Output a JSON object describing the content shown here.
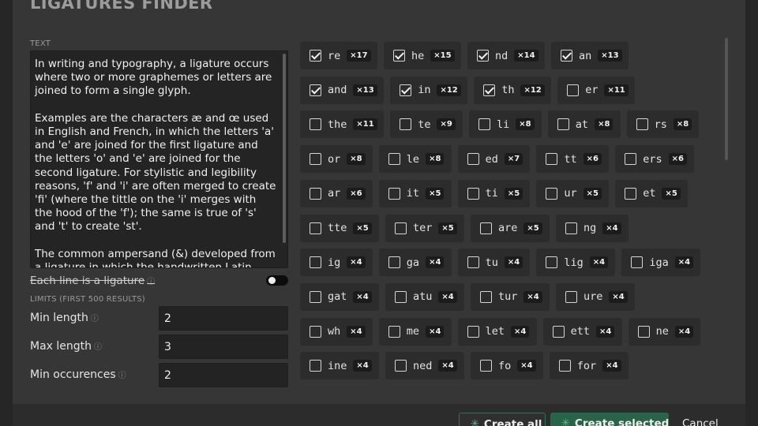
{
  "dialog": {
    "title": "LIGATURES FINDER"
  },
  "text_section": {
    "label": "TEXT",
    "content": "In writing and typography, a ligature occurs where two or more graphemes or letters are joined to form a single glyph.\n\nExamples are the characters æ and œ used in English and French, in which the letters 'a' and 'e' are joined for the first ligature and the letters 'o' and 'e' are joined for the second ligature. For stylistic and legibility reasons, 'f' and 'i' are often merged to create 'fi' (where the tittle on the 'i' merges with the hood of the 'f'); the same is true of 's' and 't' to create 'st'.\n\nThe common ampersand (&) developed from a ligature in which the handwritten Latin letters 'e' and 't' (spelling et, Latin for 'and') were combined."
  },
  "toggle": {
    "label": "Each line is a ligature",
    "info": "ⓘ",
    "on": false
  },
  "limits": {
    "label": "LIMITS (FIRST 500 RESULTS)",
    "fields": [
      {
        "label": "Min length",
        "info": "ⓘ",
        "value": "2"
      },
      {
        "label": "Max length",
        "info": "ⓘ",
        "value": "3"
      },
      {
        "label": "Min occurences",
        "info": "ⓘ",
        "value": "2"
      }
    ]
  },
  "results": [
    [
      {
        "text": "re",
        "count": "×17",
        "checked": true
      },
      {
        "text": "he",
        "count": "×15",
        "checked": true
      },
      {
        "text": "nd",
        "count": "×14",
        "checked": true
      },
      {
        "text": "an",
        "count": "×13",
        "checked": true
      }
    ],
    [
      {
        "text": "and",
        "count": "×13",
        "checked": true
      },
      {
        "text": "in",
        "count": "×12",
        "checked": true
      },
      {
        "text": "th",
        "count": "×12",
        "checked": true
      },
      {
        "text": "er",
        "count": "×11",
        "checked": false
      }
    ],
    [
      {
        "text": "the",
        "count": "×11",
        "checked": false
      },
      {
        "text": "te",
        "count": "×9",
        "checked": false
      },
      {
        "text": "li",
        "count": "×8",
        "checked": false
      },
      {
        "text": "at",
        "count": "×8",
        "checked": false
      },
      {
        "text": "rs",
        "count": "×8",
        "checked": false
      }
    ],
    [
      {
        "text": "or",
        "count": "×8",
        "checked": false
      },
      {
        "text": "le",
        "count": "×8",
        "checked": false
      },
      {
        "text": "ed",
        "count": "×7",
        "checked": false
      },
      {
        "text": "tt",
        "count": "×6",
        "checked": false
      },
      {
        "text": "ers",
        "count": "×6",
        "checked": false
      }
    ],
    [
      {
        "text": "ar",
        "count": "×6",
        "checked": false
      },
      {
        "text": "it",
        "count": "×5",
        "checked": false
      },
      {
        "text": "ti",
        "count": "×5",
        "checked": false
      },
      {
        "text": "ur",
        "count": "×5",
        "checked": false
      },
      {
        "text": "et",
        "count": "×5",
        "checked": false
      }
    ],
    [
      {
        "text": "tte",
        "count": "×5",
        "checked": false
      },
      {
        "text": "ter",
        "count": "×5",
        "checked": false
      },
      {
        "text": "are",
        "count": "×5",
        "checked": false
      },
      {
        "text": "ng",
        "count": "×4",
        "checked": false
      }
    ],
    [
      {
        "text": "ig",
        "count": "×4",
        "checked": false
      },
      {
        "text": "ga",
        "count": "×4",
        "checked": false
      },
      {
        "text": "tu",
        "count": "×4",
        "checked": false
      },
      {
        "text": "lig",
        "count": "×4",
        "checked": false
      },
      {
        "text": "iga",
        "count": "×4",
        "checked": false
      }
    ],
    [
      {
        "text": "gat",
        "count": "×4",
        "checked": false
      },
      {
        "text": "atu",
        "count": "×4",
        "checked": false
      },
      {
        "text": "tur",
        "count": "×4",
        "checked": false
      },
      {
        "text": "ure",
        "count": "×4",
        "checked": false
      }
    ],
    [
      {
        "text": "wh",
        "count": "×4",
        "checked": false
      },
      {
        "text": "me",
        "count": "×4",
        "checked": false
      },
      {
        "text": "let",
        "count": "×4",
        "checked": false
      },
      {
        "text": "ett",
        "count": "×4",
        "checked": false
      },
      {
        "text": "ne",
        "count": "×4",
        "checked": false
      }
    ],
    [
      {
        "text": "ine",
        "count": "×4",
        "checked": false
      },
      {
        "text": "ned",
        "count": "×4",
        "checked": false
      },
      {
        "text": "fo",
        "count": "×4",
        "checked": false
      },
      {
        "text": "for",
        "count": "×4",
        "checked": false
      }
    ]
  ],
  "footer": {
    "create_all": "Create all",
    "create_selected": "Create selected",
    "cancel": "Cancel",
    "spark_glyph": "✳"
  },
  "colors": {
    "accent_green": "#29634a",
    "accent_border": "#2e7253",
    "background": "#363636"
  }
}
